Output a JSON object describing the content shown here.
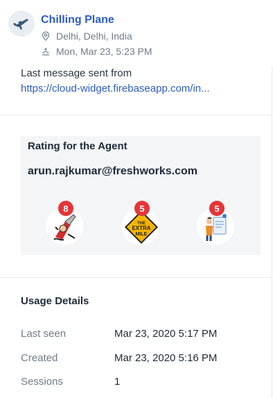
{
  "header": {
    "title": "Chilling Plane",
    "location": "Delhi, Delhi, India",
    "timestamp": "Mon, Mar 23, 5:23 PM",
    "avatar_icon": "plane-icon",
    "location_icon": "map-pin-icon",
    "time_icon": "sunrise-icon"
  },
  "last_message": {
    "label": "Last message sent from",
    "link": "https://cloud-widget.firebaseapp.com/in..."
  },
  "rating": {
    "title": "Rating for the Agent",
    "agent_email": "arun.rajkumar@freshworks.com",
    "badges": [
      {
        "count": "8",
        "icon": "guitar-player-icon"
      },
      {
        "count": "5",
        "icon": "extra-mile-sign-icon",
        "sign_text": [
          "THE",
          "EXTRA",
          "MILE"
        ]
      },
      {
        "count": "5",
        "icon": "helper-person-icon"
      }
    ]
  },
  "usage": {
    "title": "Usage Details",
    "rows": [
      {
        "label": "Last seen",
        "value": "Mar 23, 2020 5:17 PM"
      },
      {
        "label": "Created",
        "value": "Mar 23, 2020 5:16 PM"
      },
      {
        "label": "Sessions",
        "value": "1"
      }
    ]
  },
  "colors": {
    "link": "#2c5cc5",
    "badge_count": "#e43538",
    "card_bg": "#f3f5f7",
    "muted": "#6f7c87"
  }
}
